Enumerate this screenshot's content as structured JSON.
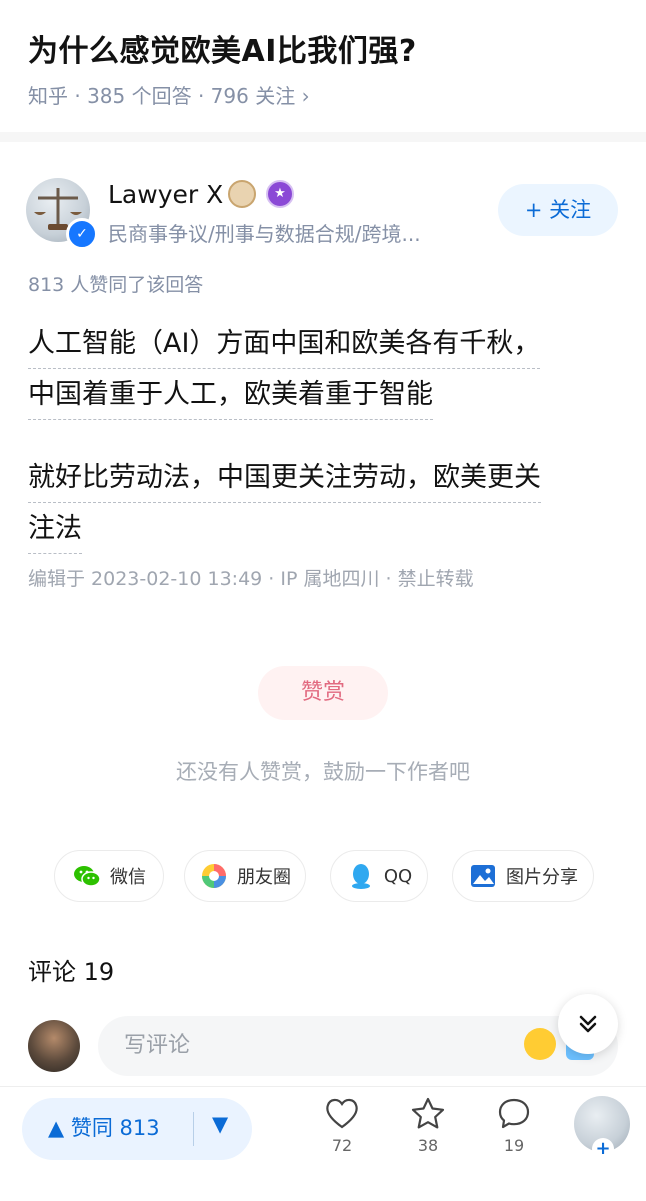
{
  "question": {
    "title": "为什么感觉欧美AI比我们强?",
    "meta": "知乎 · 385 个回答 · 796 关注 ›"
  },
  "author": {
    "name": "Lawyer X",
    "description": "民商事争议/刑事与数据合规/跨境...",
    "follow_label": "+ 关注"
  },
  "answer": {
    "upvote_note": "813 人赞同了该回答",
    "para1_line1": "人工智能（AI）方面中国和欧美各有千秋，",
    "para1_line2": "中国着重于人工，欧美着重于智能",
    "para2_line1": "就好比劳动法，中国更关注劳动，欧美更关",
    "para2_line2": "注法",
    "edit_meta": "编辑于 2023-02-10 13:49 · IP 属地四川 · 禁止转载"
  },
  "reward": {
    "button_label": "赞赏",
    "note": "还没有人赞赏，鼓励一下作者吧"
  },
  "share": {
    "wechat": "微信",
    "moments": "朋友圈",
    "qq": "QQ",
    "image": "图片分享"
  },
  "comments": {
    "title": "评论 19",
    "placeholder": "写评论"
  },
  "bottom_bar": {
    "upvote_label": "▲  赞同 813",
    "downvote_label": "▼",
    "like_count": "72",
    "favorite_count": "38",
    "comment_count": "19"
  },
  "colors": {
    "accent": "#0b6bd6",
    "reward": "#e26a80",
    "muted": "#8590a6"
  }
}
